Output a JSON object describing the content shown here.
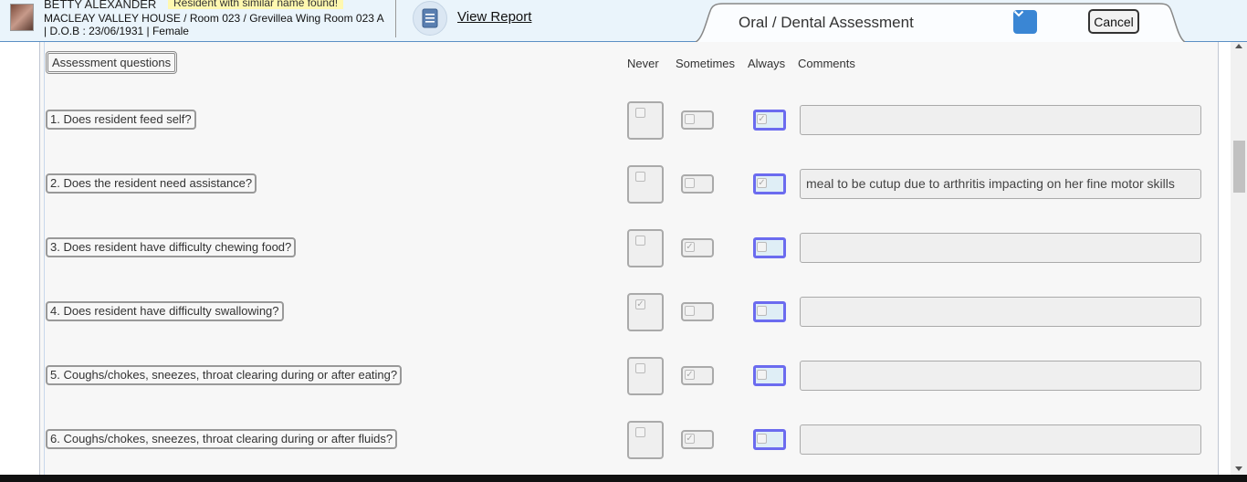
{
  "header": {
    "resident_name": "BETTY ALEXANDER",
    "warning": "Resident with similar name found!",
    "location": "MACLEAY VALLEY HOUSE / Room 023 / Grevillea Wing Room 023 A",
    "dob_gender": "| D.O.B : 23/06/1931 | Female",
    "view_report": "View Report",
    "tab_title": "Oral / Dental Assessment",
    "cancel": "Cancel"
  },
  "table": {
    "questions_header": "Assessment questions",
    "col_never": "Never",
    "col_sometimes": "Sometimes",
    "col_always": "Always",
    "col_comments": "Comments"
  },
  "rows": [
    {
      "question": "1. Does resident feed self?",
      "never": false,
      "sometimes": false,
      "always": true,
      "comment": ""
    },
    {
      "question": "2. Does the resident need assistance?",
      "never": false,
      "sometimes": false,
      "always": true,
      "comment": "meal to be cutup due to arthritis impacting on her fine motor skills"
    },
    {
      "question": "3. Does resident have difficulty chewing food?",
      "never": false,
      "sometimes": true,
      "always": false,
      "comment": ""
    },
    {
      "question": "4. Does resident have difficulty swallowing?",
      "never": true,
      "sometimes": false,
      "always": false,
      "comment": ""
    },
    {
      "question": "5. Coughs/chokes, sneezes, throat clearing during or after eating?",
      "never": false,
      "sometimes": true,
      "always": false,
      "comment": ""
    },
    {
      "question": "6. Coughs/chokes, sneezes, throat clearing during or after fluids?",
      "never": false,
      "sometimes": true,
      "always": false,
      "comment": ""
    }
  ],
  "colors": {
    "accent": "#3a86d4",
    "always_border": "#6b6bef",
    "header_bg": "#eaf4fb"
  }
}
